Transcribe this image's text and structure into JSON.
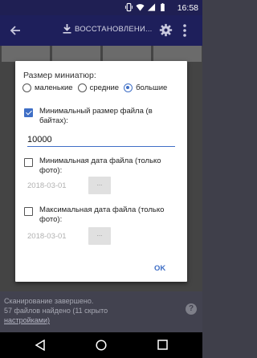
{
  "statusbar": {
    "time": "16:58",
    "icons": [
      "vibrate-icon",
      "wifi-icon",
      "signal-icon",
      "battery-icon"
    ]
  },
  "appbar": {
    "title": "ВОССТАНОВЛЕНИ..."
  },
  "bottom": {
    "line1": "Сканирование завершено.",
    "line2": "57 файлов найдено (11 скрыто",
    "line3": "настройками)",
    "help": "?"
  },
  "dialog": {
    "title": "Размер миниатюр:",
    "radios": [
      {
        "label": "маленькие",
        "checked": false
      },
      {
        "label": "средние",
        "checked": false
      },
      {
        "label": "большие",
        "checked": true
      }
    ],
    "min_size": {
      "label": "Минимальный размер файла (в байтах):",
      "checked": true,
      "value": "10000"
    },
    "min_date": {
      "label": "Минимальная дата файла (только фото):",
      "checked": false,
      "date": "2018-03-01",
      "button": "..."
    },
    "max_date": {
      "label": "Максимальная дата файла (только фото):",
      "checked": false,
      "date": "2018-03-01",
      "button": "..."
    },
    "ok": "OK"
  },
  "colors": {
    "accent": "#3f6fc6",
    "appbar": "#1e1f5b",
    "statusbar": "#1f1f53"
  }
}
